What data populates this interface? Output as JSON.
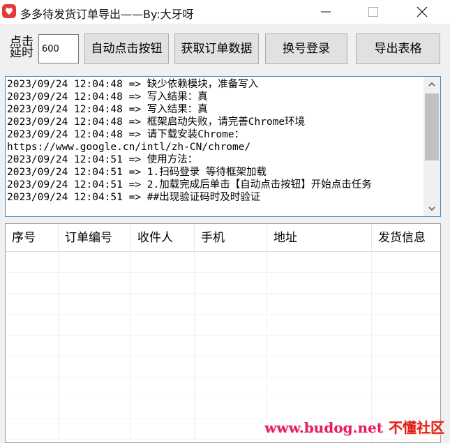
{
  "window": {
    "title": "多多待发货订单导出——By:大牙呀"
  },
  "toolbar": {
    "delay_label": "点击延时",
    "delay_value": "600",
    "auto_click_label": "自动点击按钮",
    "fetch_orders_label": "获取订单数据",
    "switch_account_label": "换号登录",
    "export_label": "导出表格"
  },
  "log": {
    "lines": [
      "2023/09/24 12:04:48 => 缺少依赖模块，准备写入",
      "2023/09/24 12:04:48 => 写入结果：真",
      "2023/09/24 12:04:48 => 写入结果：真",
      "2023/09/24 12:04:48 => 框架启动失败，请完善Chrome环境",
      "2023/09/24 12:04:48 => 请下载安装Chrome：",
      "https://www.google.cn/intl/zh-CN/chrome/",
      "2023/09/24 12:04:51 => 使用方法：",
      "2023/09/24 12:04:51 => 1.扫码登录 等待框架加载",
      "2023/09/24 12:04:51 => 2.加载完成后单击【自动点击按钮】开始点击任务",
      "2023/09/24 12:04:51 => ##出现验证码时及时验证"
    ]
  },
  "table": {
    "columns": [
      "序号",
      "订单编号",
      "收件人",
      "手机",
      "地址",
      "发货信息"
    ]
  },
  "watermark": {
    "url": "www.budog.net",
    "name": "不懂社区"
  },
  "colors": {
    "app_icon": "#e53a36",
    "log_border": "#3c89d0",
    "watermark": "#e31b23"
  }
}
